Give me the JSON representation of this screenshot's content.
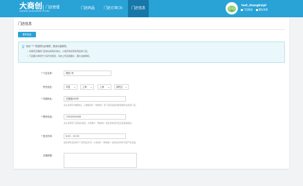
{
  "header": {
    "logo_text": "大商创",
    "logo_subtitle": "BUSINESS MANAGEMENT SYSTEM",
    "store_admin": "门店管理",
    "tabs": [
      {
        "label": "门店商品"
      },
      {
        "label": "门店订单(3)"
      },
      {
        "label": "门店信息"
      }
    ],
    "user": {
      "name": "test_shanghaipt",
      "actions": [
        {
          "label": "门店前台"
        },
        {
          "label": "退出系统"
        }
      ]
    }
  },
  "main": {
    "title": "门店信息",
    "primary_button": "基本信息",
    "tips": {
      "title": "标识 \"*\" 的选项为必填项，其余为选填项。",
      "lines": [
        "请填写正确的门店地址和联系信息，以免影响买家找到您的门店。",
        "门店图片单张尺寸请符合规定，请勿上传违规图片，图片会被审核。"
      ]
    },
    "form": {
      "store_name": {
        "label": "* 门店名称：",
        "value": "明阳1号"
      },
      "region": {
        "label": "所在地区：",
        "country": "中国",
        "province": "上海",
        "city": "上海",
        "district": "普陀区"
      },
      "address": {
        "label": "* 详细地址：",
        "value": "白鹿路888号",
        "hint": "请认真填写详细地址，以确保用户（购物者）线下到店自提时能准确到达您的门店。"
      },
      "phone": {
        "label": "* 联系电话：",
        "value": "13658589988",
        "hint": "请认真填写门店联系电话，方便用户（购物者）通过该电话与您直接取得联系。"
      },
      "hours": {
        "label": "* 营业时间：",
        "value": "8:00 - 20:00",
        "hint": "如实填写您的线下门店营业时间，以免用户（购物者）在营业时间外到店产生误会。"
      },
      "traffic": {
        "label": "交通线路："
      }
    }
  },
  "colors": {
    "header_blue": "#29a2d6",
    "active_tab": "#1677a8",
    "tip_bg": "#eaf7fb"
  }
}
